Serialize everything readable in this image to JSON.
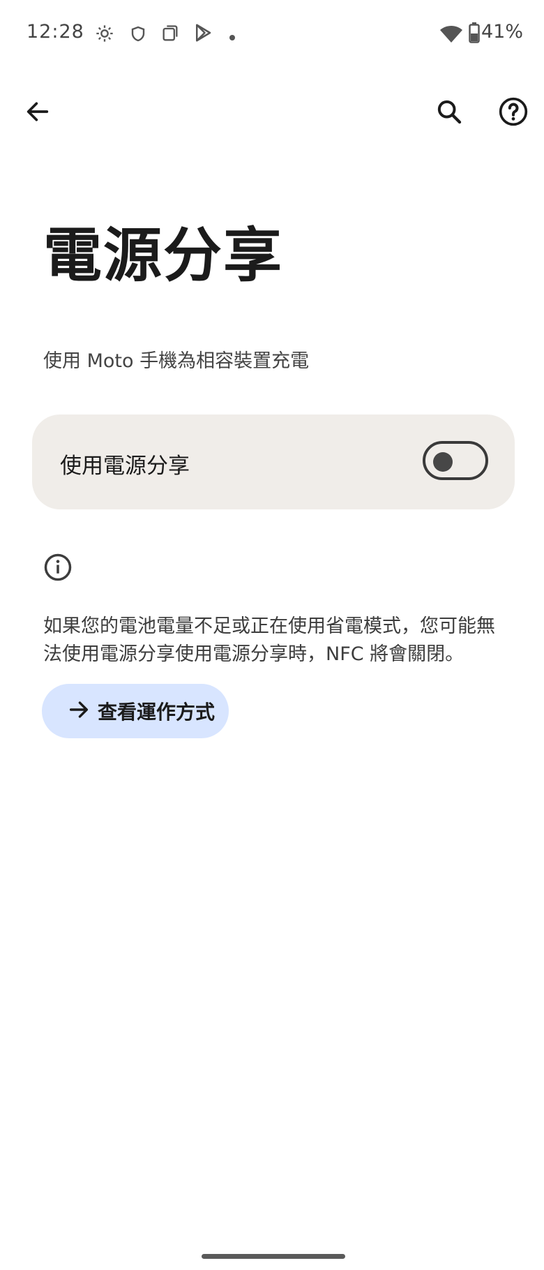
{
  "status_bar": {
    "time": "12:28",
    "battery_percent": "41%",
    "icons": [
      "gear-icon",
      "shield-icon",
      "screenshot-icon",
      "play-store-icon",
      "dot-icon",
      "wifi-icon",
      "battery-icon"
    ]
  },
  "app_bar": {
    "back_icon": "arrow-left-icon",
    "search_icon": "search-icon",
    "help_icon": "help-circle-icon"
  },
  "page": {
    "title": "電源分享",
    "subtitle": "使用 Moto 手機為相容裝置充電"
  },
  "toggle": {
    "label": "使用電源分享",
    "enabled": false
  },
  "info": {
    "icon": "info-icon",
    "text": "如果您的電池電量不足或正在使用省電模式，您可能無法使用電源分享使用電源分享時，NFC 將會關閉。"
  },
  "learn_button": {
    "label": "查看運作方式",
    "icon": "arrow-right-icon"
  },
  "colors": {
    "card_bg": "#f0ede9",
    "button_bg": "#d8e5ff",
    "text_primary": "#1b1b1b"
  }
}
